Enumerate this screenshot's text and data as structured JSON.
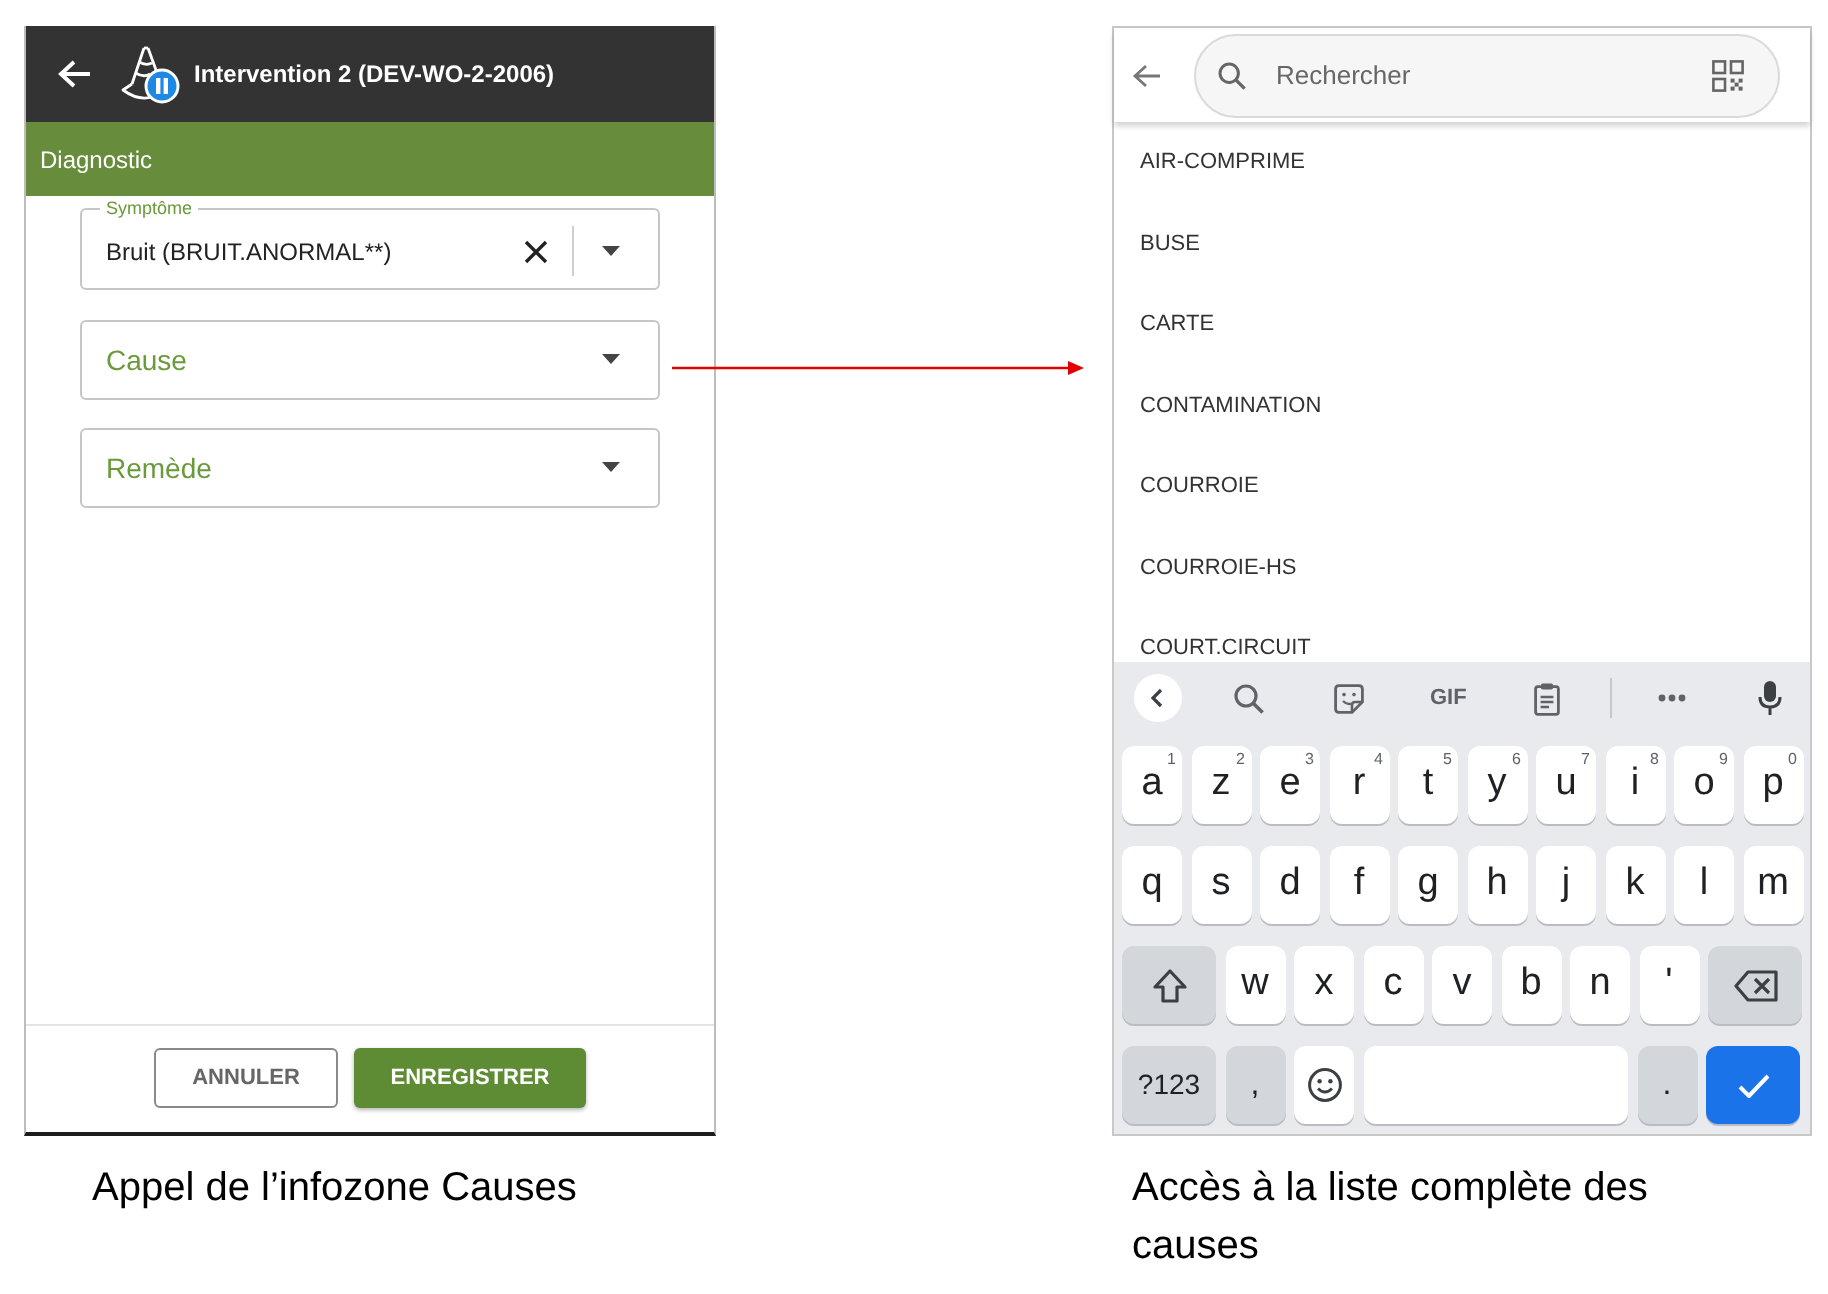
{
  "left_screen": {
    "header": {
      "title": "Intervention 2 (DEV-WO-2-2006)"
    },
    "section": {
      "title": "Diagnostic"
    },
    "fields": [
      {
        "label": "Symptôme",
        "value": "Bruit (BRUIT.ANORMAL**)",
        "clearable": true
      },
      {
        "placeholder": "Cause",
        "clearable": false
      },
      {
        "placeholder": "Remède",
        "clearable": false
      }
    ],
    "buttons": [
      {
        "label": "ANNULER",
        "kind": "outlined"
      },
      {
        "label": "ENREGISTRER",
        "kind": "filled"
      }
    ]
  },
  "left_caption": "Appel de l’infozone Causes",
  "right_screen": {
    "search": {
      "placeholder": "Rechercher"
    },
    "list_items": [
      "AIR-COMPRIME",
      "BUSE",
      "CARTE",
      "CONTAMINATION",
      "COURROIE",
      "COURROIE-HS",
      "COURT.CIRCUIT"
    ],
    "keyboard": {
      "toolbar": {
        "gif_label": "GIF"
      },
      "rows": [
        [
          {
            "kind": "char",
            "label": "a",
            "hint": "1"
          },
          {
            "kind": "char",
            "label": "z",
            "hint": "2"
          },
          {
            "kind": "char",
            "label": "e",
            "hint": "3"
          },
          {
            "kind": "char",
            "label": "r",
            "hint": "4"
          },
          {
            "kind": "char",
            "label": "t",
            "hint": "5"
          },
          {
            "kind": "char",
            "label": "y",
            "hint": "6"
          },
          {
            "kind": "char",
            "label": "u",
            "hint": "7"
          },
          {
            "kind": "char",
            "label": "i",
            "hint": "8"
          },
          {
            "kind": "char",
            "label": "o",
            "hint": "9"
          },
          {
            "kind": "char",
            "label": "p",
            "hint": "0"
          }
        ],
        [
          {
            "kind": "char",
            "label": "q"
          },
          {
            "kind": "char",
            "label": "s"
          },
          {
            "kind": "char",
            "label": "d"
          },
          {
            "kind": "char",
            "label": "f"
          },
          {
            "kind": "char",
            "label": "g"
          },
          {
            "kind": "char",
            "label": "h"
          },
          {
            "kind": "char",
            "label": "j"
          },
          {
            "kind": "char",
            "label": "k"
          },
          {
            "kind": "char",
            "label": "l"
          },
          {
            "kind": "char",
            "label": "m"
          }
        ],
        [
          {
            "kind": "shift"
          },
          {
            "kind": "char",
            "label": "w"
          },
          {
            "kind": "char",
            "label": "x"
          },
          {
            "kind": "char",
            "label": "c"
          },
          {
            "kind": "char",
            "label": "v"
          },
          {
            "kind": "char",
            "label": "b"
          },
          {
            "kind": "char",
            "label": "n"
          },
          {
            "kind": "char",
            "label": "'"
          },
          {
            "kind": "backspace"
          }
        ],
        [
          {
            "kind": "symbols",
            "label": "?123"
          },
          {
            "kind": "punctuation",
            "label": ","
          },
          {
            "kind": "emoji"
          },
          {
            "kind": "space"
          },
          {
            "kind": "punctuation",
            "label": "."
          },
          {
            "kind": "enter"
          }
        ]
      ]
    }
  },
  "right_caption": "Accès à la liste complète des causes"
}
